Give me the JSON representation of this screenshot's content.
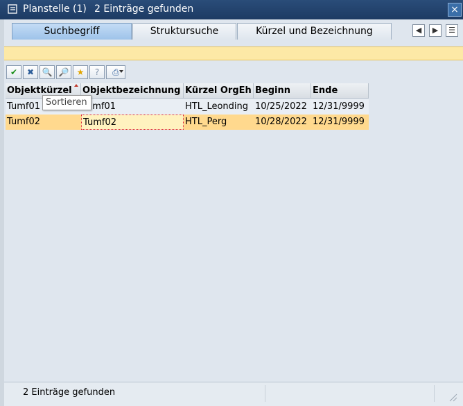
{
  "window": {
    "title": "Planstelle (1)",
    "subtitle": "2 Einträge gefunden",
    "close_label": "×"
  },
  "tabs": [
    {
      "label": "Suchbegriff",
      "active": true
    },
    {
      "label": "Struktursuche",
      "active": false
    },
    {
      "label": "Kürzel und Bezeichnung",
      "active": false
    }
  ],
  "tab_nav": {
    "prev": "◀",
    "next": "▶",
    "list": "☰"
  },
  "toolbar": {
    "buttons": [
      {
        "name": "confirm-icon",
        "glyph": "✔"
      },
      {
        "name": "cancel-icon",
        "glyph": "✖"
      },
      {
        "name": "find-icon",
        "glyph": "🔍"
      },
      {
        "name": "find-next-icon",
        "glyph": "🔎"
      },
      {
        "name": "new-entry-icon",
        "glyph": "★"
      },
      {
        "name": "help-icon",
        "glyph": "?"
      },
      {
        "name": "print-icon",
        "glyph": "⎙"
      }
    ]
  },
  "table": {
    "columns": [
      "Objektkürzel",
      "Objektbezeichnung",
      "Kürzel OrgEh",
      "Beginn",
      "Ende"
    ],
    "rows": [
      [
        "Tumf01",
        "Tumf01",
        "HTL_Leonding",
        "10/25/2022",
        "12/31/9999"
      ],
      [
        "Tumf02",
        "Tumf02",
        "HTL_Perg",
        "10/28/2022",
        "12/31/9999"
      ]
    ]
  },
  "tooltip": {
    "text": "Sortieren"
  },
  "status": {
    "text": "2 Einträge gefunden"
  },
  "colors": {
    "title_bar": "#1d3a63",
    "selected_row": "#ffd98e",
    "active_tab": "#9ec3ea",
    "info_bar": "#fde9a6"
  }
}
